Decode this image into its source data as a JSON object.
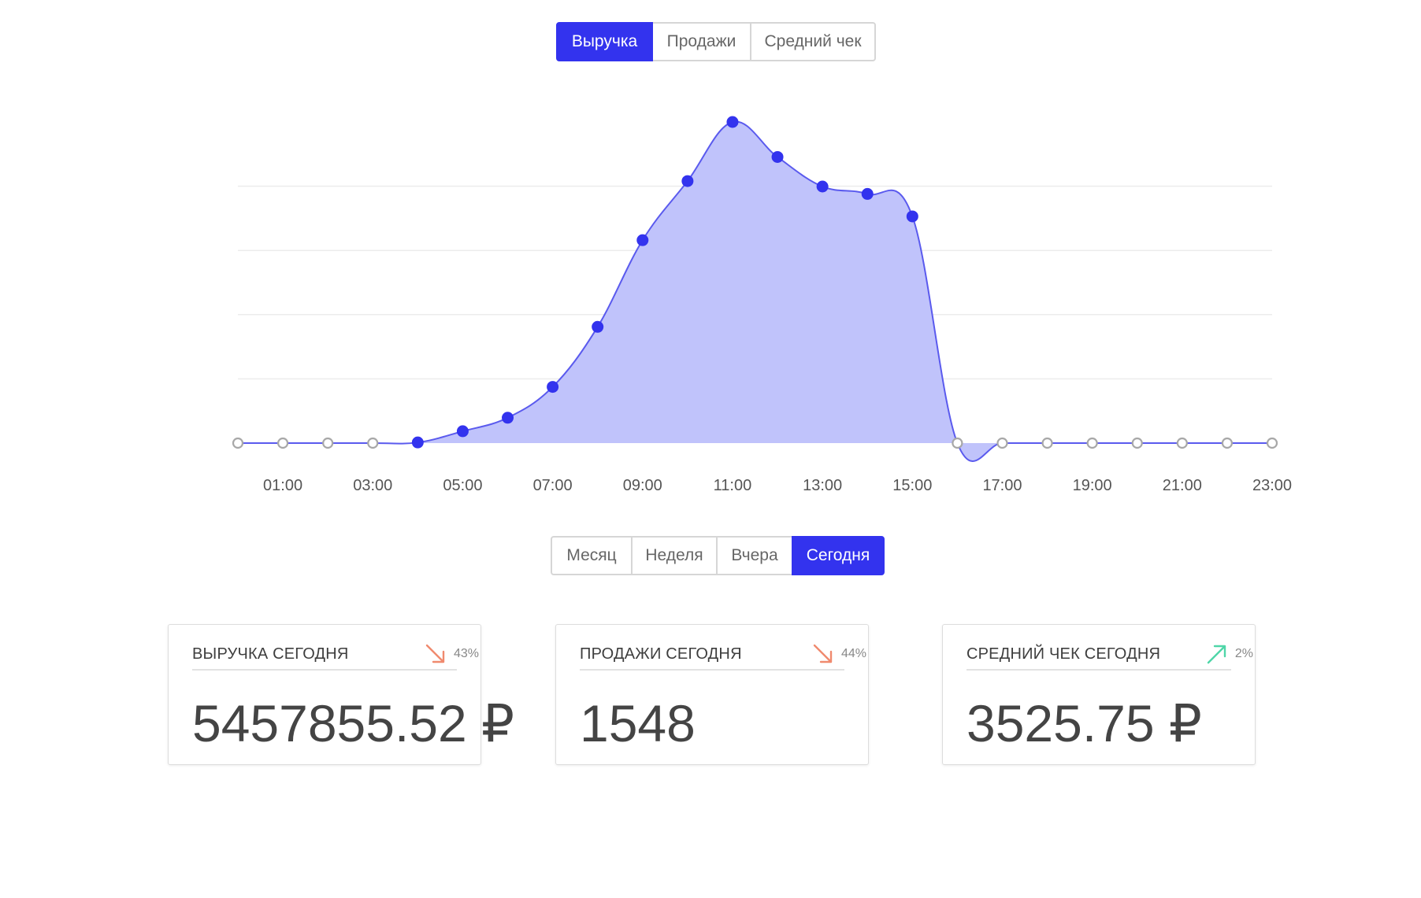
{
  "metric_tabs": [
    {
      "label": "Выручка",
      "active": true
    },
    {
      "label": "Продажи",
      "active": false
    },
    {
      "label": "Средний чек",
      "active": false
    }
  ],
  "period_tabs": [
    {
      "label": "Месяц",
      "active": false
    },
    {
      "label": "Неделя",
      "active": false
    },
    {
      "label": "Вчера",
      "active": false
    },
    {
      "label": "Сегодня",
      "active": true
    }
  ],
  "colors": {
    "accent": "#3333ee",
    "area_fill": "#c0c3fb",
    "line": "#5a5aee",
    "trend_down": "#f08a6e",
    "trend_up": "#4fd6a8"
  },
  "cards": [
    {
      "title": "ВЫРУЧКА СЕГОДНЯ",
      "trend_icon": "arrow-down-right-icon",
      "trend_direction": "down",
      "trend_value": "43%",
      "value": "5457855.52 ₽"
    },
    {
      "title": "ПРОДАЖИ СЕГОДНЯ",
      "trend_icon": "arrow-down-right-icon",
      "trend_direction": "down",
      "trend_value": "44%",
      "value": "1548"
    },
    {
      "title": "СРЕДНИЙ ЧЕК СЕГОДНЯ",
      "trend_icon": "arrow-up-right-icon",
      "trend_direction": "up",
      "trend_value": "2%",
      "value": "3525.75 ₽"
    }
  ],
  "chart_data": {
    "type": "area",
    "x": [
      "00:00",
      "01:00",
      "02:00",
      "03:00",
      "04:00",
      "05:00",
      "06:00",
      "07:00",
      "08:00",
      "09:00",
      "10:00",
      "11:00",
      "12:00",
      "13:00",
      "14:00",
      "15:00",
      "16:00",
      "17:00",
      "18:00",
      "19:00",
      "20:00",
      "21:00",
      "22:00",
      "23:00"
    ],
    "x_tick_labels": [
      "01:00",
      "03:00",
      "05:00",
      "07:00",
      "09:00",
      "11:00",
      "13:00",
      "15:00",
      "17:00",
      "19:00",
      "21:00",
      "23:00"
    ],
    "series": [
      {
        "values": [
          0,
          0,
          0,
          0,
          0.2,
          3.7,
          7.9,
          17.5,
          36.2,
          63.2,
          81.6,
          100,
          89.1,
          79.9,
          77.6,
          70.6,
          0,
          0,
          0,
          0,
          0,
          0,
          0,
          0
        ]
      }
    ],
    "ylim": [
      0,
      100
    ],
    "y_gridlines": [
      20,
      40,
      60,
      80
    ],
    "grid": true,
    "legend": "none"
  }
}
